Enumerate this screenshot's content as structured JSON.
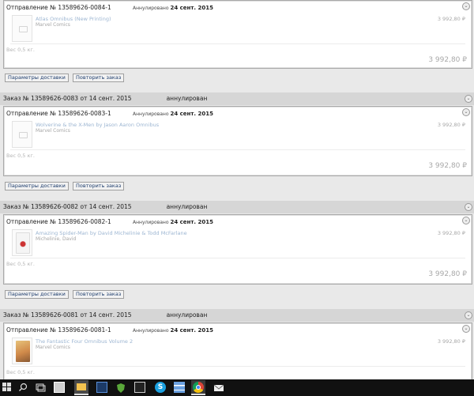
{
  "orders": [
    {
      "header": "",
      "status": "",
      "shipment": {
        "title": "Отправление № 13589626-0084-1",
        "status_prefix": "Аннулировано",
        "status_date": "24 сент. 2015",
        "item_title": "Atlas Omnibus (New Printing)",
        "item_publisher": "Marvel Comics",
        "item_price": "3 992,80 ₽",
        "weight": "Вес 0,5 кг.",
        "total": "3 992,80 ₽",
        "thumb": "placeholder"
      },
      "buttons": [
        "Параметры доставки",
        "Повторить заказ"
      ]
    },
    {
      "header": "Заказ  № 13589626-0083  от  14 сент. 2015",
      "status": "аннулирован",
      "shipment": {
        "title": "Отправление № 13589626-0083-1",
        "status_prefix": "Аннулировано",
        "status_date": "24 сент. 2015",
        "item_title": "Wolverine & the X-Men by Jason Aaron Omnibus",
        "item_publisher": "Marvel Comics",
        "item_price": "3 992,80 ₽",
        "weight": "Вес 0,5 кг.",
        "total": "3 992,80 ₽",
        "thumb": "placeholder"
      },
      "buttons": [
        "Параметры доставки",
        "Повторить заказ"
      ]
    },
    {
      "header": "Заказ  № 13589626-0082  от  14 сент. 2015",
      "status": "аннулирован",
      "shipment": {
        "title": "Отправление № 13589626-0082-1",
        "status_prefix": "Аннулировано",
        "status_date": "24 сент. 2015",
        "item_title": "Amazing Spider-Man by David Michelinie & Todd McFarlane",
        "item_publisher": "Michelinie, David",
        "item_price": "3 992,80 ₽",
        "weight": "Вес 0,5 кг.",
        "total": "3 992,80 ₽",
        "thumb": "spiderman-cover"
      },
      "buttons": [
        "Параметры доставки",
        "Повторить заказ"
      ]
    },
    {
      "header": "Заказ  № 13589626-0081  от  14 сент. 2015",
      "status": "аннулирован",
      "shipment": {
        "title": "Отправление № 13589626-0081-1",
        "status_prefix": "Аннулировано",
        "status_date": "24 сент. 2015",
        "item_title": "The Fantastic Four Omnibus Volume 2",
        "item_publisher": "Marvel Comics",
        "item_price": "3 992,80 ₽",
        "weight": "Вес 0,5 кг.",
        "total": "",
        "thumb": "fantastic-four-cover"
      },
      "buttons": []
    }
  ],
  "toggle_glyph": "⌄",
  "taskbar": {
    "icons": [
      "windows-start-icon",
      "search-icon",
      "task-view-icon",
      "explorer-icon",
      "file-explorer-icon",
      "photoshop-icon",
      "shield-icon",
      "media-icon",
      "skype-icon",
      "stack-icon",
      "chrome-icon",
      "mail-icon"
    ]
  },
  "colors": {
    "link": "#9db6d2",
    "button_text": "#1f3e6e",
    "header_bg": "#d6d6d6"
  }
}
